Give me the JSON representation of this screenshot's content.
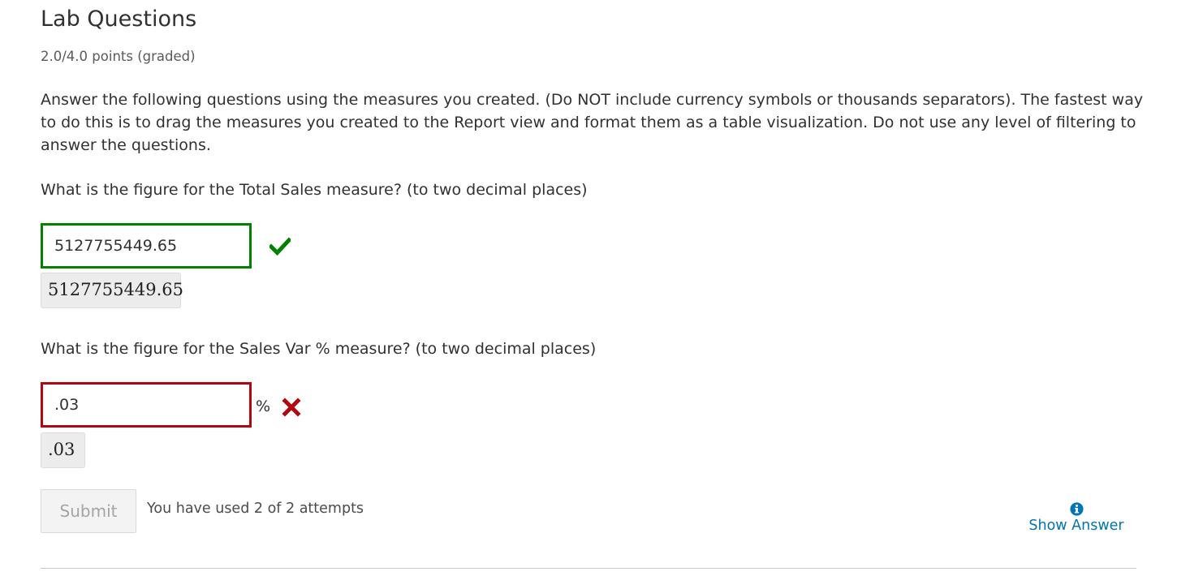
{
  "problem": {
    "title": "Lab Questions",
    "points": "2.0/4.0 points (graded)",
    "intro": "Answer the following questions using the measures you created. (Do NOT include currency symbols or thousands separators). The fastest way to do this is to drag the measures you created to the Report view and format them as a table visualization. Do not use any level of filtering to answer the questions."
  },
  "questions": [
    {
      "text": "What is the figure for the Total Sales measure? (to two decimal places)",
      "answer_value": "5127755449.65",
      "preview": "5127755449.65",
      "status": "correct",
      "status_icon": "checkmark-icon",
      "status_color": "#008100"
    },
    {
      "text": "What is the figure for the Sales Var % measure? (to two decimal places)",
      "answer_value": ".03",
      "unit": "%",
      "preview": ".03",
      "status": "incorrect",
      "status_icon": "cross-icon",
      "status_color": "#b20610"
    }
  ],
  "actions": {
    "submit_label": "Submit",
    "attempts_text": "You have used 2 of 2 attempts",
    "show_answer_label": "Show Answer",
    "show_answer_icon": "info-icon",
    "link_color": "#0075b4"
  }
}
